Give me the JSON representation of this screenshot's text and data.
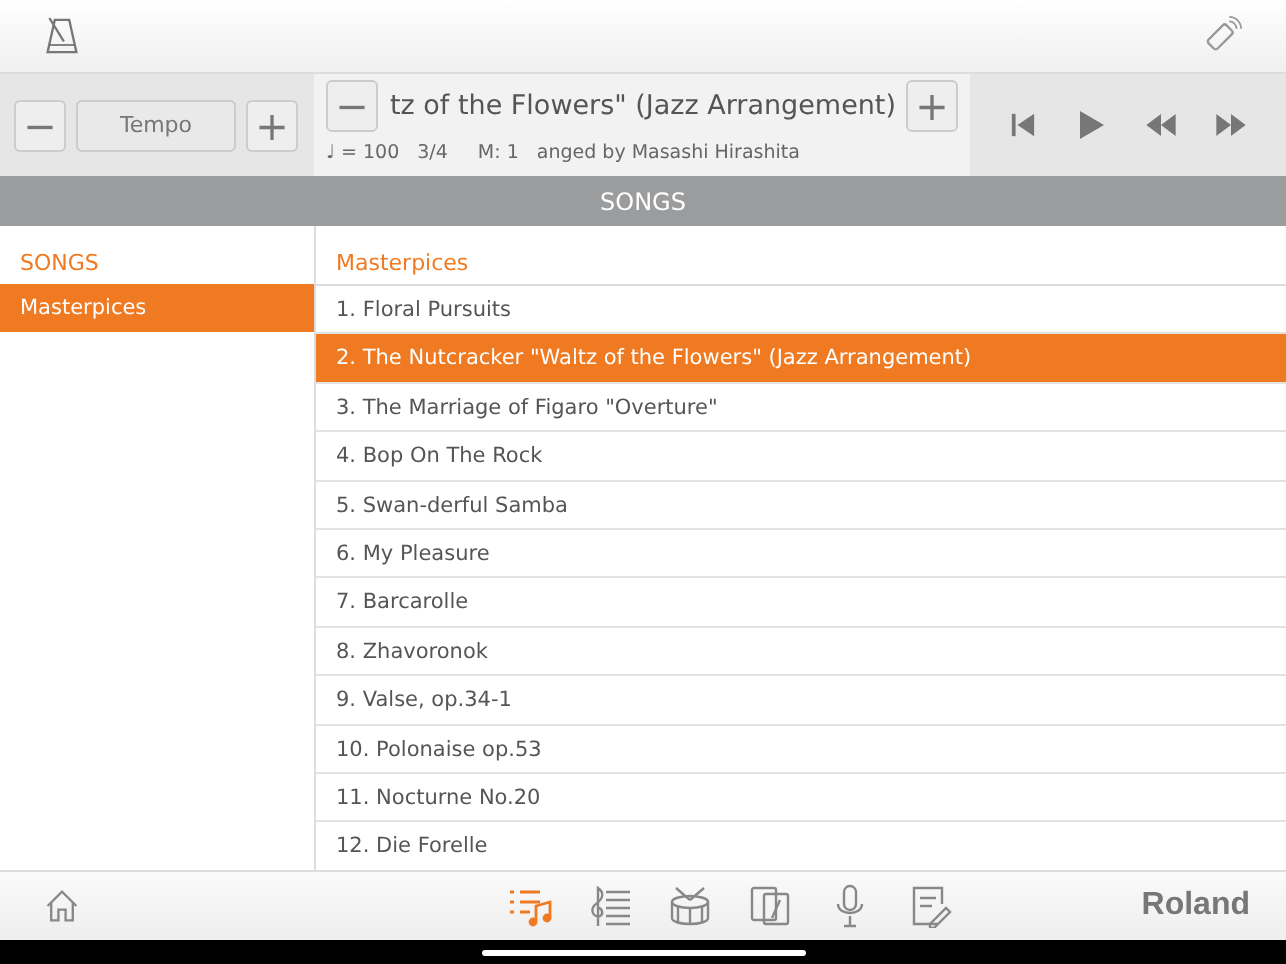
{
  "tempo": {
    "minus": "−",
    "label": "Tempo",
    "plus": "+"
  },
  "song": {
    "minus": "−",
    "title": "tz of the Flowers\" (Jazz Arrangement)",
    "plus": "+",
    "tempo": "♩ = 100",
    "meter": "3/4",
    "measure": "M: 1",
    "composer": "anged by Masashi Hirashita"
  },
  "header": "SONGS",
  "sidebar": {
    "title": "SONGS",
    "items": [
      {
        "label": "Masterpices",
        "selected": true
      }
    ]
  },
  "list": {
    "title": "Masterpices",
    "items": [
      {
        "label": "1.  Floral Pursuits",
        "selected": false
      },
      {
        "label": "2.  The Nutcracker \"Waltz of the Flowers\" (Jazz Arrangement)",
        "selected": true
      },
      {
        "label": "3.  The Marriage of Figaro \"Overture\"",
        "selected": false
      },
      {
        "label": "4.  Bop On The Rock",
        "selected": false
      },
      {
        "label": "5.  Swan-derful Samba",
        "selected": false
      },
      {
        "label": "6.  My Pleasure",
        "selected": false
      },
      {
        "label": "7.  Barcarolle",
        "selected": false
      },
      {
        "label": "8.  Zhavoronok",
        "selected": false
      },
      {
        "label": "9.  Valse, op.34-1",
        "selected": false
      },
      {
        "label": "10.  Polonaise op.53",
        "selected": false
      },
      {
        "label": "11.  Nocturne No.20",
        "selected": false
      },
      {
        "label": "12.  Die Forelle",
        "selected": false
      }
    ]
  },
  "tabs": [
    {
      "kind": "songs",
      "selected": true
    },
    {
      "kind": "score",
      "selected": false
    },
    {
      "kind": "drum",
      "selected": false
    },
    {
      "kind": "tablet",
      "selected": false
    },
    {
      "kind": "mic",
      "selected": false
    },
    {
      "kind": "notes",
      "selected": false
    }
  ],
  "logo": "Roland"
}
